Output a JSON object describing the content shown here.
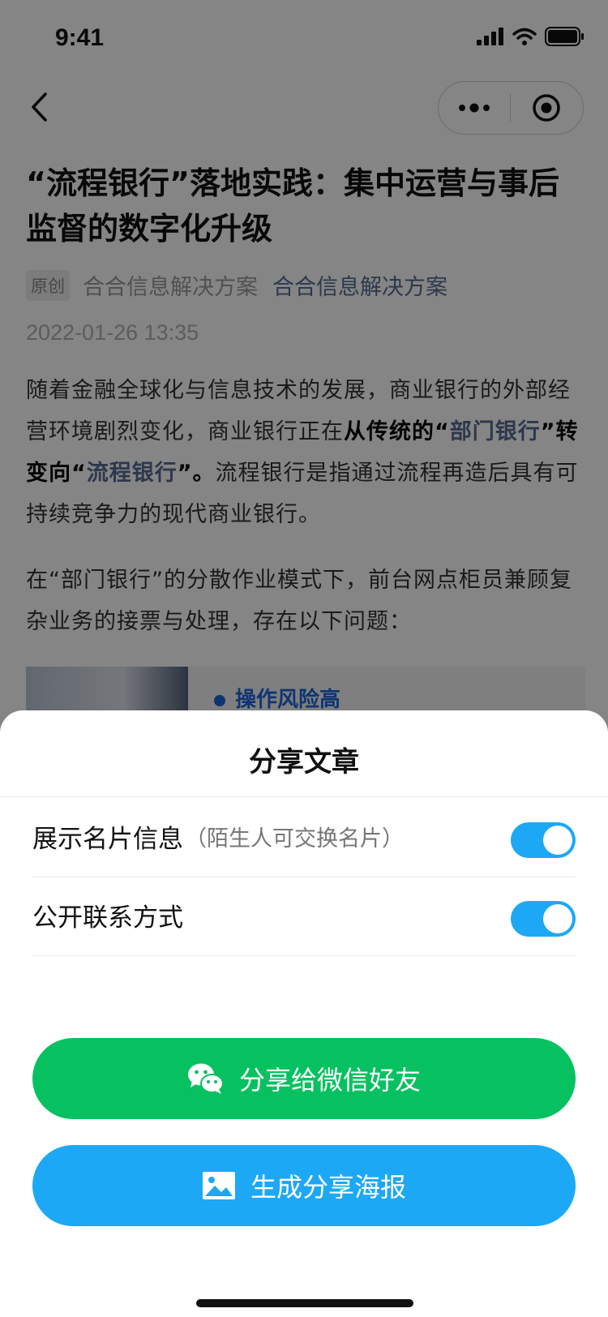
{
  "status_bar": {
    "time": "9:41"
  },
  "nav": {
    "back_icon": "chevron-left-icon",
    "more_icon": "more-dots-icon",
    "close_icon": "target-circle-icon"
  },
  "article": {
    "title": "“流程银行”落地实践：集中运营与事后监督的数字化升级",
    "tag": "原创",
    "author": "合合信息解决方案",
    "account": "合合信息解决方案",
    "date": "2022-01-26 13:35",
    "para1": {
      "part1": "随着金融全球化与信息技术的发展，商业银行的外部经营环境剧烈变化，商业银行正在",
      "part2": "从传统的“",
      "part3": "部门银行",
      "part4": "”转变向“",
      "part5": "流程银行",
      "part6": "”。",
      "part7": "流程银行是指通过流程再造后具有可持续竞争力的现代商业银行。"
    },
    "para2": "在“部门银行”的分散作业模式下，前台网点柜员兼顾复杂业务的接票与处理，存在以下问题：",
    "card_text": "操作风险高"
  },
  "sheet": {
    "title": "分享文章",
    "option1": {
      "label": "展示名片信息",
      "sub": "（陌生人可交换名片）",
      "on": true
    },
    "option2": {
      "label": "公开联系方式",
      "on": true
    },
    "wechat_button": "分享给微信好友",
    "poster_button": "生成分享海报"
  },
  "colors": {
    "wechat_green": "#07c160",
    "primary_blue": "#1da8f5",
    "link_blue": "#576b95"
  }
}
